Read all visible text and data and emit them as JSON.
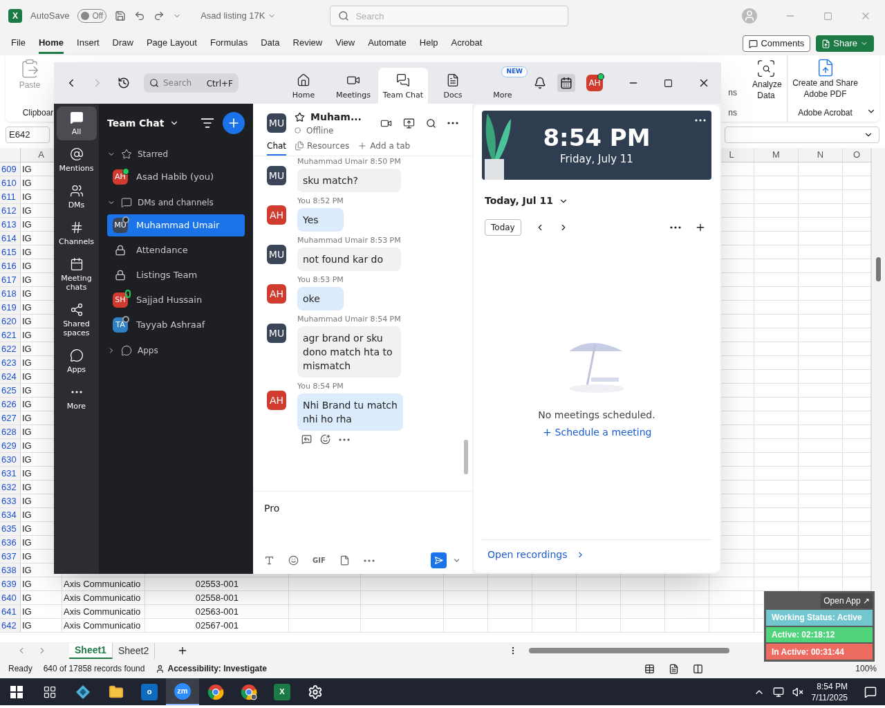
{
  "excel": {
    "title_bar": {
      "app_letter": "X",
      "autosave_label": "AutoSave",
      "autosave": {
        "on": false,
        "label": "Off"
      },
      "file_name": "Asad listing 17K",
      "search_placeholder": "Search"
    },
    "menu": [
      {
        "label": "File",
        "selected": false
      },
      {
        "label": "Home",
        "selected": true
      },
      {
        "label": "Insert",
        "selected": false
      },
      {
        "label": "Draw",
        "selected": false
      },
      {
        "label": "Page Layout",
        "selected": false
      },
      {
        "label": "Formulas",
        "selected": false
      },
      {
        "label": "Data",
        "selected": false
      },
      {
        "label": "Review",
        "selected": false
      },
      {
        "label": "View",
        "selected": false
      },
      {
        "label": "Automate",
        "selected": false
      },
      {
        "label": "Help",
        "selected": false
      },
      {
        "label": "Acrobat",
        "selected": false
      }
    ],
    "comments_button": "Comments",
    "share_button": "Share",
    "ribbon": {
      "paste": "Paste",
      "clipboard_group": "Clipboar",
      "cut_button": "ns",
      "cut_group": "ns",
      "analyze_data": "Analyze Data",
      "create_pdf": "Create and Share Adobe PDF",
      "acrobat_group": "Adobe Acrobat"
    },
    "name_box": "E642",
    "grid": {
      "column_headers_left": [
        "A"
      ],
      "column_headers_right": [
        "L",
        "M",
        "N",
        "O"
      ],
      "rows": [
        {
          "number": "609",
          "cells": [
            "IG"
          ]
        },
        {
          "number": "610",
          "cells": [
            "IG"
          ]
        },
        {
          "number": "611",
          "cells": [
            "IG"
          ]
        },
        {
          "number": "612",
          "cells": [
            "IG"
          ]
        },
        {
          "number": "613",
          "cells": [
            "IG"
          ]
        },
        {
          "number": "614",
          "cells": [
            "IG"
          ]
        },
        {
          "number": "615",
          "cells": [
            "IG"
          ]
        },
        {
          "number": "616",
          "cells": [
            "IG"
          ]
        },
        {
          "number": "617",
          "cells": [
            "IG"
          ]
        },
        {
          "number": "618",
          "cells": [
            "IG"
          ]
        },
        {
          "number": "619",
          "cells": [
            "IG"
          ]
        },
        {
          "number": "620",
          "cells": [
            "IG"
          ]
        },
        {
          "number": "621",
          "cells": [
            "IG"
          ]
        },
        {
          "number": "622",
          "cells": [
            "IG"
          ]
        },
        {
          "number": "623",
          "cells": [
            "IG"
          ]
        },
        {
          "number": "624",
          "cells": [
            "IG"
          ]
        },
        {
          "number": "625",
          "cells": [
            "IG"
          ]
        },
        {
          "number": "626",
          "cells": [
            "IG"
          ]
        },
        {
          "number": "627",
          "cells": [
            "IG"
          ]
        },
        {
          "number": "628",
          "cells": [
            "IG"
          ]
        },
        {
          "number": "629",
          "cells": [
            "IG"
          ]
        },
        {
          "number": "630",
          "cells": [
            "IG"
          ]
        },
        {
          "number": "631",
          "cells": [
            "IG"
          ]
        },
        {
          "number": "632",
          "cells": [
            "IG"
          ]
        },
        {
          "number": "633",
          "cells": [
            "IG"
          ]
        },
        {
          "number": "634",
          "cells": [
            "IG"
          ]
        },
        {
          "number": "635",
          "cells": [
            "IG"
          ]
        },
        {
          "number": "636",
          "cells": [
            "IG"
          ]
        },
        {
          "number": "637",
          "cells": [
            "IG"
          ]
        },
        {
          "number": "638",
          "cells": [
            "IG"
          ]
        },
        {
          "number": "639",
          "cells": [
            "IG",
            "Axis Communicatio",
            "02553-001"
          ]
        },
        {
          "number": "640",
          "cells": [
            "IG",
            "Axis Communicatio",
            "02558-001"
          ]
        },
        {
          "number": "641",
          "cells": [
            "IG",
            "Axis Communicatio",
            "02563-001"
          ]
        },
        {
          "number": "642",
          "cells": [
            "IG",
            "Axis Communicatio",
            "02567-001"
          ]
        }
      ]
    },
    "sheet_tabs": [
      {
        "label": "Sheet1",
        "selected": true
      },
      {
        "label": "Sheet2",
        "selected": false
      }
    ],
    "status_bar": {
      "ready": "Ready",
      "records": "640 of 17858 records found",
      "accessibility": "Accessibility: Investigate",
      "zoom": "100%"
    }
  },
  "zoom": {
    "search": {
      "placeholder": "Search",
      "shortcut": "Ctrl+F"
    },
    "tabs": [
      {
        "label": "Home",
        "kind": "home",
        "selected": false
      },
      {
        "label": "Meetings",
        "kind": "meetings",
        "selected": false
      },
      {
        "label": "Team Chat",
        "kind": "chat",
        "selected": true
      },
      {
        "label": "Docs",
        "kind": "docs",
        "selected": false
      },
      {
        "label": "More",
        "kind": "more",
        "selected": false,
        "badge": "NEW"
      }
    ],
    "profile": {
      "initials": "AH",
      "color": "#d13b2f",
      "online": true
    },
    "rail": [
      {
        "label": "All",
        "kind": "all",
        "selected": true
      },
      {
        "label": "Mentions",
        "kind": "mentions",
        "selected": false
      },
      {
        "label": "DMs",
        "kind": "dms",
        "selected": false
      },
      {
        "label": "Channels",
        "kind": "channels",
        "selected": false
      },
      {
        "label": "Meeting chats",
        "kind": "meetings",
        "selected": false
      },
      {
        "label": "Shared spaces",
        "kind": "shared",
        "selected": false
      },
      {
        "label": "Apps",
        "kind": "apps",
        "selected": false
      },
      {
        "label": "More",
        "kind": "more",
        "selected": false
      }
    ],
    "list_title": "Team Chat",
    "sections": [
      {
        "label": "Starred",
        "kind": "star",
        "expanded": true,
        "children": [
          {
            "label": "Asad Habib (you)",
            "kind": "person",
            "initials": "AH",
            "color": "#d13b2f",
            "online": true,
            "mobile": false,
            "selected": false
          }
        ]
      },
      {
        "label": "DMs and channels",
        "kind": "chat",
        "expanded": true,
        "children": [
          {
            "label": "Muhammad Umair",
            "kind": "person",
            "initials": "MU",
            "color": "#3a4658",
            "online": false,
            "mobile": false,
            "selected": true
          },
          {
            "label": "Attendance",
            "kind": "channel",
            "selected": false
          },
          {
            "label": "Listings Team",
            "kind": "channel",
            "selected": false
          },
          {
            "label": "Sajjad Hussain",
            "kind": "person",
            "initials": "SH",
            "color": "#d13b2f",
            "online": true,
            "mobile": true,
            "selected": false
          },
          {
            "label": "Tayyab Ashraaf",
            "kind": "person",
            "initials": "TA",
            "color": "#2f80c4",
            "online": false,
            "mobile": false,
            "selected": false
          }
        ]
      },
      {
        "label": "Apps",
        "kind": "apps",
        "expanded": false
      }
    ],
    "chat": {
      "initials": "MU",
      "color": "#3a4658",
      "name": "Muham...",
      "status": "Offline",
      "tabs": [
        {
          "label": "Chat",
          "kind": "chat",
          "selected": true
        },
        {
          "label": "Resources",
          "kind": "resources",
          "selected": false
        },
        {
          "label": "Add a tab",
          "kind": "add",
          "selected": false
        }
      ],
      "messages": [
        {
          "kind": "theirs",
          "initials": "MU",
          "color": "#3a4658",
          "sender": "Muhammad Umair",
          "time": "8:50 PM",
          "lines": [
            "sku match?"
          ]
        },
        {
          "kind": "mine",
          "initials": "AH",
          "color": "#d13b2f",
          "sender": "You",
          "time": "8:52 PM",
          "lines": [
            "Yes"
          ]
        },
        {
          "kind": "theirs",
          "initials": "MU",
          "color": "#3a4658",
          "sender": "Muhammad Umair",
          "time": "8:53 PM",
          "lines": [
            "not found kar do"
          ]
        },
        {
          "kind": "mine",
          "initials": "AH",
          "color": "#d13b2f",
          "sender": "You",
          "time": "8:53 PM",
          "lines": [
            "oke"
          ]
        },
        {
          "kind": "theirs",
          "initials": "MU",
          "color": "#3a4658",
          "sender": "Muhammad Umair",
          "time": "8:54 PM",
          "lines": [
            "agr brand or sku",
            "dono match hta to",
            "mismatch"
          ]
        },
        {
          "kind": "mine",
          "initials": "AH",
          "color": "#d13b2f",
          "sender": "You",
          "time": "8:54 PM",
          "lines": [
            "Nhi Brand tu match",
            "nhi ho rha"
          ]
        }
      ],
      "compose_value": "Pro",
      "gif_label": "GIF"
    },
    "calendar": {
      "time": "8:54 PM",
      "date": "Friday, July 11",
      "day_heading": "Today, Jul 11",
      "today_button": "Today",
      "empty_text": "No meetings scheduled.",
      "schedule_link": "Schedule a meeting",
      "recordings_link": "Open recordings"
    }
  },
  "tracker": {
    "open_app": "Open App ↗",
    "rows": [
      {
        "label": "Working Status: Active",
        "color": "#72c6cf"
      },
      {
        "label": "Active: 02:18:12",
        "color": "#4fd37b"
      },
      {
        "label": "In Active: 00:31:44",
        "color": "#ee6b61"
      }
    ]
  },
  "taskbar": {
    "apps": [
      {
        "kind": "taskview",
        "selected": false
      },
      {
        "kind": "app",
        "selected": false
      },
      {
        "kind": "folder",
        "selected": false
      },
      {
        "kind": "outlook",
        "selected": false,
        "letter": "o"
      },
      {
        "kind": "zoom",
        "selected": true,
        "letter": "zm"
      },
      {
        "kind": "chrome",
        "selected": false
      },
      {
        "kind": "chrome-profile",
        "selected": false
      },
      {
        "kind": "excel",
        "selected": false,
        "letter": "X"
      },
      {
        "kind": "settings",
        "selected": false
      }
    ],
    "time": "8:54 PM",
    "date": "7/11/2025"
  }
}
